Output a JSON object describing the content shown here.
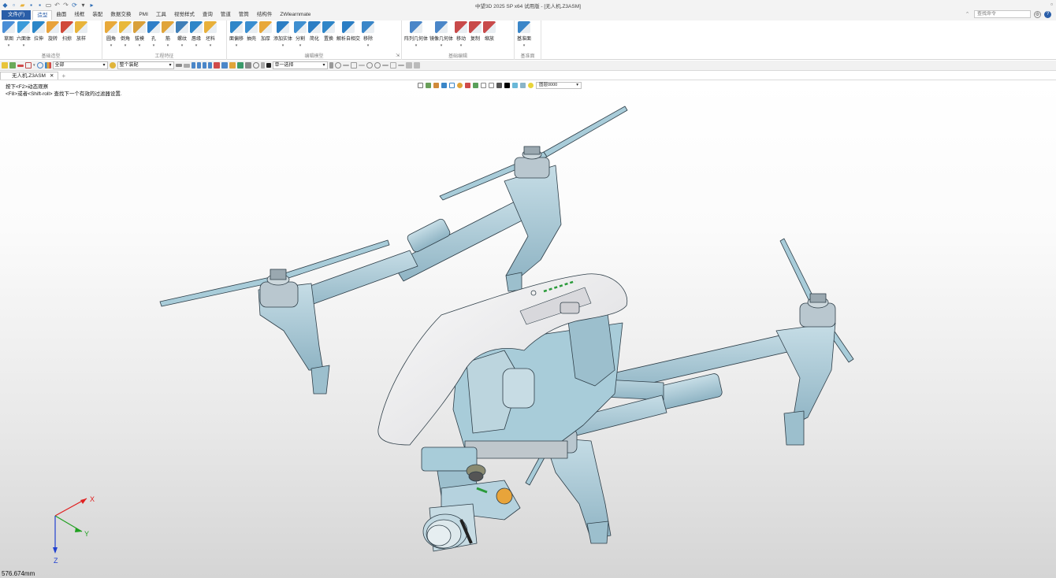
{
  "window": {
    "title": "中望3D 2025 SP x64 试用版 - [无人机.Z3ASM]"
  },
  "menu": {
    "file_label": "文件(F)",
    "tabs": [
      "造型",
      "曲面",
      "线框",
      "装配",
      "数据交换",
      "PMI",
      "工具",
      "视觉样式",
      "查询",
      "管道",
      "管筒",
      "结构件",
      "ZWlearnmate"
    ],
    "active_tab_index": 0,
    "search_placeholder": "查找命令"
  },
  "ribbon": {
    "groups": [
      {
        "label": "基础造型",
        "buttons": [
          {
            "label": "草图",
            "icon": "sketch-icon",
            "color": "#4a8ed6",
            "dropdown": true
          },
          {
            "label": "六面体",
            "icon": "box-icon",
            "color": "#3a9ad9",
            "dropdown": true
          },
          {
            "label": "拉伸",
            "icon": "extrude-icon",
            "color": "#2b86c8",
            "dropdown": false
          },
          {
            "label": "旋转",
            "icon": "revolve-icon",
            "color": "#e8a23a",
            "dropdown": false
          },
          {
            "label": "扫掠",
            "icon": "sweep-icon",
            "color": "#d04a3a",
            "dropdown": false
          },
          {
            "label": "放样",
            "icon": "loft-icon",
            "color": "#e8b43a",
            "dropdown": false
          }
        ]
      },
      {
        "label": "工程特征",
        "buttons": [
          {
            "label": "圆角",
            "icon": "fillet-icon",
            "color": "#e8a93a",
            "dropdown": true
          },
          {
            "label": "倒角",
            "icon": "chamfer-icon",
            "color": "#e8b83a",
            "dropdown": true
          },
          {
            "label": "拔模",
            "icon": "draft-icon",
            "color": "#d9a03a",
            "dropdown": true
          },
          {
            "label": "孔",
            "icon": "hole-icon",
            "color": "#2f7fc8",
            "dropdown": true
          },
          {
            "label": "筋",
            "icon": "rib-icon",
            "color": "#e0a43a",
            "dropdown": true
          },
          {
            "label": "螺纹",
            "icon": "thread-icon",
            "color": "#3f7fb8",
            "dropdown": true
          },
          {
            "label": "唇缘",
            "icon": "lip-icon",
            "color": "#2e86c8",
            "dropdown": true
          },
          {
            "label": "坯料",
            "icon": "stock-icon",
            "color": "#e8b03a",
            "dropdown": true
          }
        ]
      },
      {
        "label": "编辑模型",
        "buttons": [
          {
            "label": "面偏移",
            "icon": "face-offset-icon",
            "color": "#2e86c8",
            "dropdown": true
          },
          {
            "label": "抽壳",
            "icon": "shell-icon",
            "color": "#3a8ed0",
            "dropdown": false
          },
          {
            "label": "加厚",
            "icon": "thicken-icon",
            "color": "#e8a83a",
            "dropdown": false
          },
          {
            "label": "添加实体",
            "icon": "add-shape-icon",
            "color": "#2b7ec4",
            "dropdown": true
          },
          {
            "label": "分割",
            "icon": "divide-icon",
            "color": "#3f8fd0",
            "dropdown": true
          },
          {
            "label": "简化",
            "icon": "simplify-icon",
            "color": "#2b7ec4",
            "dropdown": false
          },
          {
            "label": "置换",
            "icon": "replace-icon",
            "color": "#2f86c8",
            "dropdown": false
          },
          {
            "label": "解析自相交",
            "icon": "self-intersect-icon",
            "color": "#2b7ec4",
            "dropdown": false
          },
          {
            "label": "移除",
            "icon": "remove-icon",
            "color": "#3a86c8",
            "dropdown": true
          }
        ]
      },
      {
        "label": "基础编辑",
        "buttons": [
          {
            "label": "阵列几何体",
            "icon": "pattern-icon",
            "color": "#4a86c8",
            "dropdown": true
          },
          {
            "label": "镜像几何体",
            "icon": "mirror-icon",
            "color": "#4a86c8",
            "dropdown": true
          },
          {
            "label": "移动",
            "icon": "move-icon",
            "color": "#c84a4a",
            "dropdown": true
          },
          {
            "label": "复制",
            "icon": "copy-icon",
            "color": "#c84a4a",
            "dropdown": false
          },
          {
            "label": "缩放",
            "icon": "scale-icon",
            "color": "#c84a4a",
            "dropdown": false
          }
        ]
      },
      {
        "label": "基准面",
        "buttons": [
          {
            "label": "基准面",
            "icon": "datum-plane-icon",
            "color": "#3a86c8",
            "dropdown": true
          }
        ]
      }
    ]
  },
  "toolbar2": {
    "filter_all": "全部",
    "assembly_scope": "整个装配",
    "pick_mode": "单一选择"
  },
  "doc_tabs": [
    {
      "label": "无人机.Z3ASM",
      "active": true
    }
  ],
  "viewport": {
    "prompt_line1": "按下<F2>动态观察",
    "prompt_line2": "<F8>或者<Shift-roll> 查找下一个有效的过滤器设置.",
    "filter_select": "图层0000",
    "scale_readout": "576.674mm",
    "triad": {
      "x_label": "X",
      "y_label": "Y",
      "z_label": "Z",
      "x_color": "#e02020",
      "y_color": "#20a020",
      "z_color": "#2040d0"
    }
  },
  "colors": {
    "accent": "#2a5ea8",
    "model_blue": "#a8ccd9",
    "model_shell": "#ebebed",
    "motor_gray": "#b9c7cf"
  }
}
